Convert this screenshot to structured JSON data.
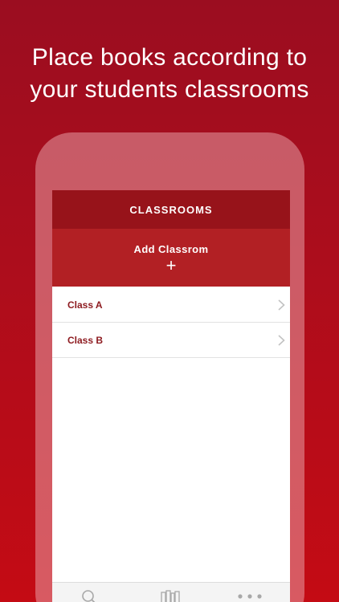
{
  "headline": {
    "line1": "Place books according to",
    "line2": "your students classrooms"
  },
  "navbar": {
    "title": "CLASSROOMS"
  },
  "add_button": {
    "label": "Add Classrom",
    "plus": "+"
  },
  "classrooms": [
    {
      "label": "Class A"
    },
    {
      "label": "Class B"
    }
  ],
  "tabbar": {
    "icons": [
      "search-icon",
      "library-icon",
      "more-icon"
    ]
  },
  "colors": {
    "background_top": "#9b0d20",
    "background_bottom": "#c40b14",
    "navbar": "#97131a",
    "add_button": "#b22024",
    "row_text": "#8d1a1f"
  }
}
